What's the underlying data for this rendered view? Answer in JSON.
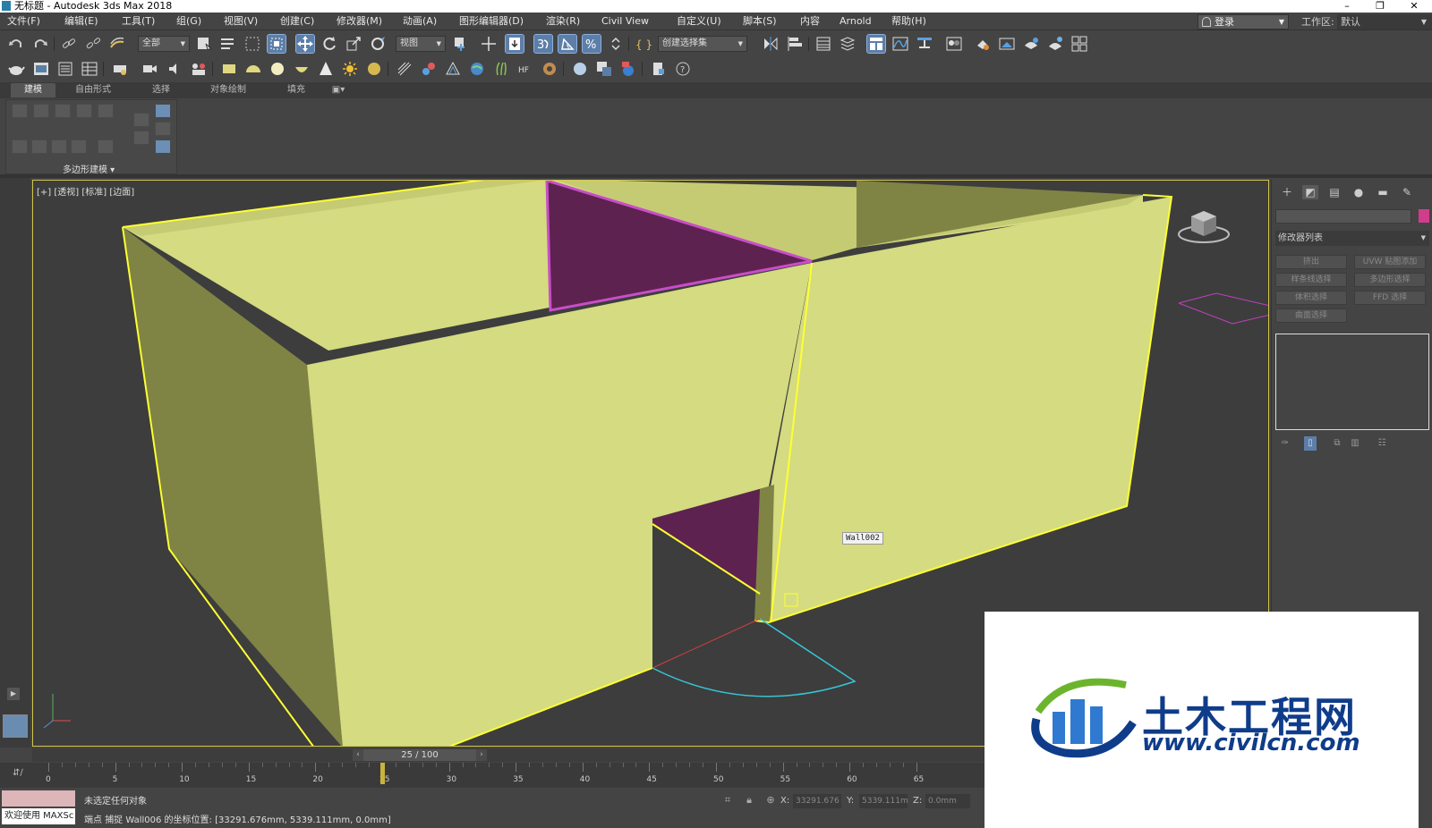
{
  "window": {
    "title": "无标题 - Autodesk 3ds Max 2018",
    "minimize": "–",
    "restore": "❐",
    "close": "✕"
  },
  "menu": {
    "items": [
      "文件(F)",
      "编辑(E)",
      "工具(T)",
      "组(G)",
      "视图(V)",
      "创建(C)",
      "修改器(M)",
      "动画(A)",
      "图形编辑器(D)",
      "渲染(R)",
      "Civil View",
      "自定义(U)",
      "脚本(S)",
      "内容",
      "Arnold",
      "帮助(H)"
    ],
    "login": "登录",
    "workspace_label": "工作区:",
    "workspace_value": "默认"
  },
  "toolbar": {
    "filter_select": "全部",
    "ref_coord_select": "视图",
    "named_selection": "创建选择集"
  },
  "ribbon": {
    "tabs": [
      "建模",
      "自由形式",
      "选择",
      "对象绘制",
      "填充"
    ],
    "active_tab": "建模",
    "panel_label": "多边形建模 ▾"
  },
  "viewport": {
    "label": "[+] [透视] [标准] [边面]",
    "object_tag": "Wall002",
    "scene_colors": {
      "wall": "#d4db80",
      "wall_dark": "#c5cb72",
      "wall_shadow": "#7f8445",
      "opening": "#5e2250",
      "wire": "#ffff33",
      "floor": "#3d3d3d"
    }
  },
  "command_panel": {
    "tabs": [
      "create-icon",
      "modify-icon",
      "hierarchy-icon",
      "motion-icon",
      "display-icon",
      "utilities-icon"
    ],
    "modifier_list": "修改器列表",
    "modifier_buttons": [
      "挤出",
      "UVW 贴图添加",
      "样条线选择",
      "多边形选择",
      "体积选择",
      "FFD 选择",
      "曲面选择"
    ],
    "object_color": "#d23c8c"
  },
  "timeline": {
    "frame_display": "25 / 100",
    "current_frame": 25,
    "total_frames": 100,
    "ticks": [
      "0",
      "5",
      "10",
      "15",
      "20",
      "25",
      "30",
      "35",
      "40",
      "45",
      "50",
      "55",
      "60",
      "65"
    ]
  },
  "status": {
    "maxscript": "欢迎使用 MAXSc",
    "line1": "未选定任何对象",
    "line2": "端点 捕捉 Wall006 的坐标位置: [33291.676mm, 5339.111mm, 0.0mm]",
    "x_label": "X:",
    "x_value": "33291.676",
    "y_label": "Y:",
    "y_value": "5339.111m",
    "z_label": "Z:",
    "z_value": "0.0mm"
  },
  "watermark": {
    "title": "土木工程网",
    "url": "www.civilcn.com"
  }
}
